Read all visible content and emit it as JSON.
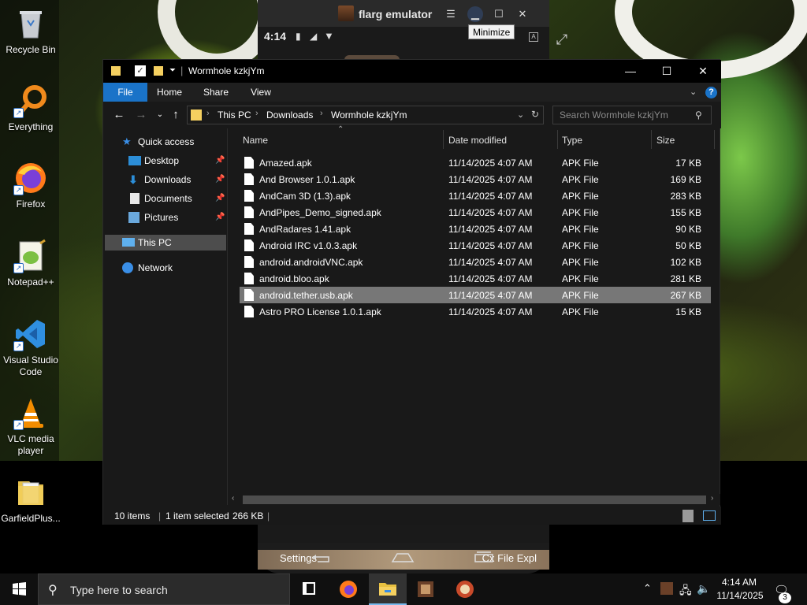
{
  "desktop": {
    "icons": [
      {
        "label": "Recycle Bin",
        "icon": "recycle-bin-icon"
      },
      {
        "label": "Everything",
        "icon": "everything-search-icon"
      },
      {
        "label": "Firefox",
        "icon": "firefox-icon"
      },
      {
        "label": "Notepad++",
        "icon": "notepad-plus-plus-icon"
      },
      {
        "label": "Visual Studio Code",
        "icon": "vscode-icon"
      },
      {
        "label": "VLC media player",
        "icon": "vlc-icon"
      },
      {
        "label": "GarfieldPlus...",
        "icon": "folder-icon"
      }
    ]
  },
  "emulator": {
    "title": "flarg emulator",
    "tooltip": "Minimize",
    "status_time": "4:14",
    "bottom_left": "Settings",
    "bottom_right": "Cx File Expl"
  },
  "explorer": {
    "title": "Wormhole kzkjYm",
    "ribbon_tabs": [
      "File",
      "Home",
      "Share",
      "View"
    ],
    "breadcrumb": [
      "This PC",
      "Downloads",
      "Wormhole kzkjYm"
    ],
    "search_placeholder": "Search Wormhole kzkjYm",
    "nav": {
      "quick_access": "Quick access",
      "items": [
        "Desktop",
        "Downloads",
        "Documents",
        "Pictures"
      ],
      "this_pc": "This PC",
      "network": "Network"
    },
    "columns": [
      "Name",
      "Date modified",
      "Type",
      "Size"
    ],
    "files": [
      {
        "name": "Amazed.apk",
        "date": "11/14/2025 4:07 AM",
        "type": "APK File",
        "size": "17 KB"
      },
      {
        "name": "And Browser 1.0.1.apk",
        "date": "11/14/2025 4:07 AM",
        "type": "APK File",
        "size": "169 KB"
      },
      {
        "name": "AndCam 3D (1.3).apk",
        "date": "11/14/2025 4:07 AM",
        "type": "APK File",
        "size": "283 KB"
      },
      {
        "name": "AndPipes_Demo_signed.apk",
        "date": "11/14/2025 4:07 AM",
        "type": "APK File",
        "size": "155 KB"
      },
      {
        "name": "AndRadares 1.41.apk",
        "date": "11/14/2025 4:07 AM",
        "type": "APK File",
        "size": "90 KB"
      },
      {
        "name": "Android IRC v1.0.3.apk",
        "date": "11/14/2025 4:07 AM",
        "type": "APK File",
        "size": "50 KB"
      },
      {
        "name": "android.androidVNC.apk",
        "date": "11/14/2025 4:07 AM",
        "type": "APK File",
        "size": "102 KB"
      },
      {
        "name": "android.bloo.apk",
        "date": "11/14/2025 4:07 AM",
        "type": "APK File",
        "size": "281 KB"
      },
      {
        "name": "android.tether.usb.apk",
        "date": "11/14/2025 4:07 AM",
        "type": "APK File",
        "size": "267 KB"
      },
      {
        "name": "Astro PRO License 1.0.1.apk",
        "date": "11/14/2025 4:07 AM",
        "type": "APK File",
        "size": "15 KB"
      }
    ],
    "selected_index": 8,
    "status": {
      "count": "10 items",
      "selection": "1 item selected",
      "size": "266 KB"
    }
  },
  "taskbar": {
    "search_text": "Type here to search",
    "time": "4:14 AM",
    "date": "11/14/2025",
    "notification_count": "3"
  },
  "colors": {
    "accent": "#1a73c8",
    "selection": "#777777",
    "window_bg": "#191919"
  }
}
